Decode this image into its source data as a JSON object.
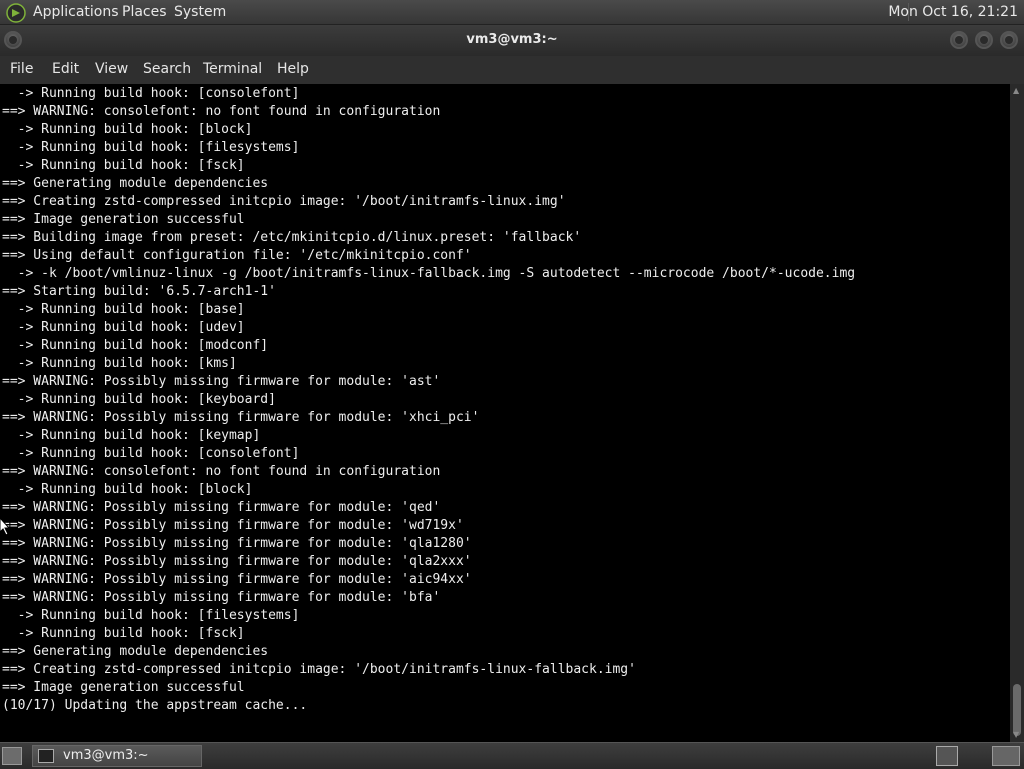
{
  "top_panel": {
    "menu": [
      "Applications",
      "Places",
      "System"
    ],
    "clock": "Mon Oct 16, 21:21"
  },
  "window": {
    "title": "vm3@vm3:~",
    "menu": [
      "File",
      "Edit",
      "View",
      "Search",
      "Terminal",
      "Help"
    ]
  },
  "terminal": {
    "lines": [
      "  -> Running build hook: [consolefont]",
      "==> WARNING: consolefont: no font found in configuration",
      "  -> Running build hook: [block]",
      "  -> Running build hook: [filesystems]",
      "  -> Running build hook: [fsck]",
      "==> Generating module dependencies",
      "==> Creating zstd-compressed initcpio image: '/boot/initramfs-linux.img'",
      "==> Image generation successful",
      "==> Building image from preset: /etc/mkinitcpio.d/linux.preset: 'fallback'",
      "==> Using default configuration file: '/etc/mkinitcpio.conf'",
      "  -> -k /boot/vmlinuz-linux -g /boot/initramfs-linux-fallback.img -S autodetect --microcode /boot/*-ucode.img",
      "==> Starting build: '6.5.7-arch1-1'",
      "  -> Running build hook: [base]",
      "  -> Running build hook: [udev]",
      "  -> Running build hook: [modconf]",
      "  -> Running build hook: [kms]",
      "==> WARNING: Possibly missing firmware for module: 'ast'",
      "  -> Running build hook: [keyboard]",
      "==> WARNING: Possibly missing firmware for module: 'xhci_pci'",
      "  -> Running build hook: [keymap]",
      "  -> Running build hook: [consolefont]",
      "==> WARNING: consolefont: no font found in configuration",
      "  -> Running build hook: [block]",
      "==> WARNING: Possibly missing firmware for module: 'qed'",
      "==> WARNING: Possibly missing firmware for module: 'wd719x'",
      "==> WARNING: Possibly missing firmware for module: 'qla1280'",
      "==> WARNING: Possibly missing firmware for module: 'qla2xxx'",
      "==> WARNING: Possibly missing firmware for module: 'aic94xx'",
      "==> WARNING: Possibly missing firmware for module: 'bfa'",
      "  -> Running build hook: [filesystems]",
      "  -> Running build hook: [fsck]",
      "==> Generating module dependencies",
      "==> Creating zstd-compressed initcpio image: '/boot/initramfs-linux-fallback.img'",
      "==> Image generation successful",
      "(10/17) Updating the appstream cache..."
    ]
  },
  "taskbar": {
    "task_label": "vm3@vm3:~"
  },
  "icons": {
    "logo": "distro-logo-icon",
    "show_desktop": "show-desktop-icon",
    "task": "terminal-icon",
    "tray": "terminal-launcher-icon"
  },
  "colors": {
    "panel": "#3a3a3a",
    "terminal_bg": "#000000",
    "terminal_fg": "#eeeeee",
    "logo": "#7fb23a"
  }
}
